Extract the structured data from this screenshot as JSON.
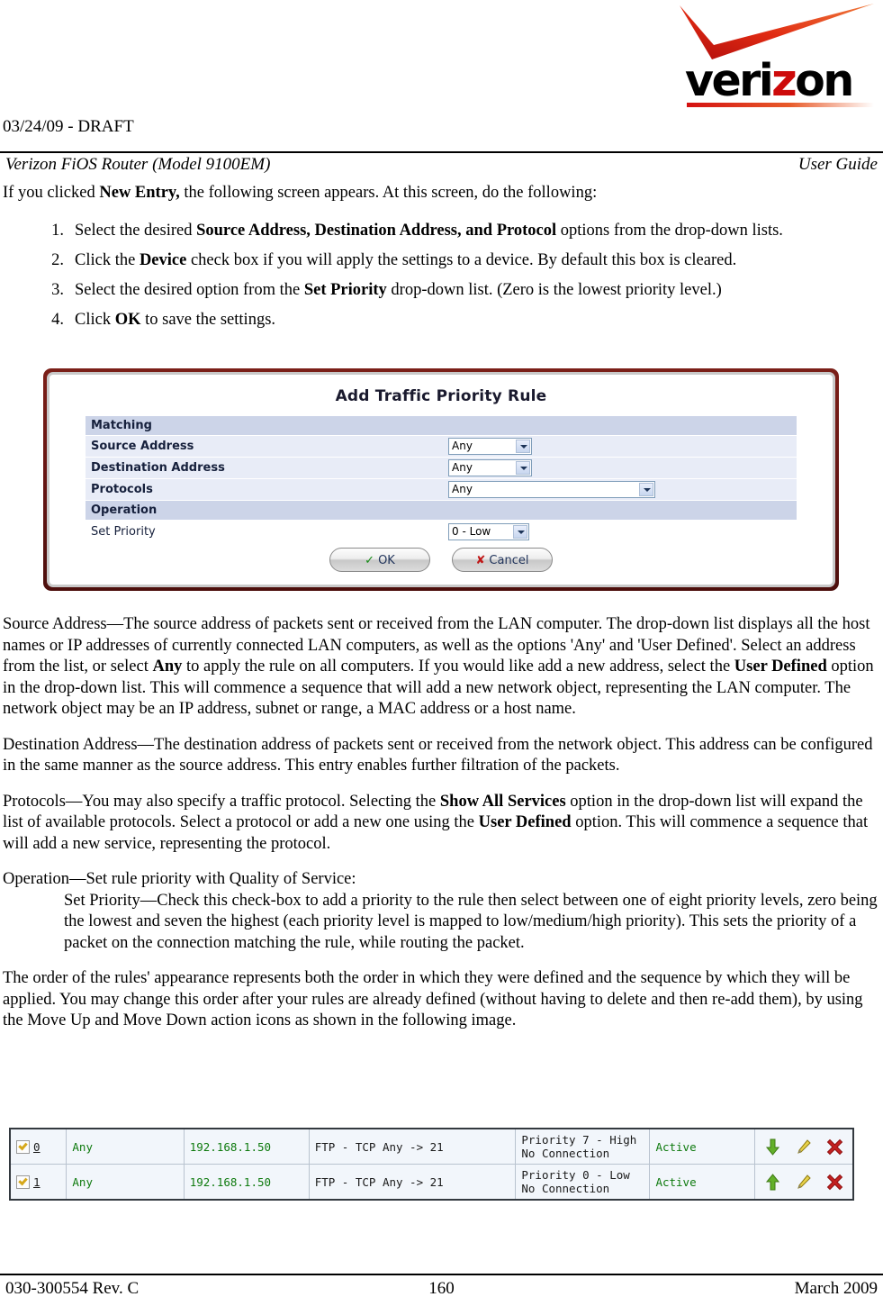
{
  "logo": {
    "wordmark": "verizon",
    "wordmark_prefix": "veri",
    "wordmark_z": "z",
    "wordmark_suffix": "on",
    "check_color": "#d41111",
    "z_color": "#cd0a0a"
  },
  "header": {
    "draft_line": "03/24/09 - DRAFT",
    "doc_title": "Verizon FiOS Router (Model 9100EM)",
    "doc_type": "User Guide"
  },
  "intro": {
    "before_bold": "If you clicked ",
    "bold": "New Entry,",
    "after_bold": " the following screen appears. At this screen, do the following:"
  },
  "steps": [
    {
      "num": "1.",
      "pre": "Select the desired ",
      "bold": "Source Address, Destination Address, and Protocol",
      "post": " options from the drop-down lists."
    },
    {
      "num": "2.",
      "pre": "Click the ",
      "bold": "Device",
      "post": " check box if you will apply the settings to a device. By default this box is cleared."
    },
    {
      "num": "3.",
      "pre": "Select the desired option from the ",
      "bold": "Set Priority",
      "post": " drop-down list. (Zero is the lowest priority level.)"
    },
    {
      "num": "4.",
      "pre": "Click ",
      "bold": "OK",
      "post": " to save the settings."
    }
  ],
  "dialog": {
    "title": "Add Traffic Priority Rule",
    "sections": [
      {
        "label": "Matching"
      },
      {
        "label": "Operation"
      }
    ],
    "fields": [
      {
        "label": "Source Address",
        "value": "Any",
        "width": "small"
      },
      {
        "label": "Destination Address",
        "value": "Any",
        "width": "small"
      },
      {
        "label": "Protocols",
        "value": "Any",
        "width": "wide"
      }
    ],
    "operation_field": {
      "label": "Set Priority",
      "value": "0 - Low"
    },
    "buttons": {
      "ok_mark": "✓",
      "ok_label": "OK",
      "cancel_mark": "✘",
      "cancel_label": "Cancel"
    }
  },
  "body_paragraphs": {
    "source_address": {
      "term": "Source Address",
      "dash": "—",
      "seg1": "The source address of packets sent or received from the LAN computer. The drop-down list displays all the host names or IP addresses of currently connected LAN computers, as well as the options 'Any' and 'User Defined'. Select an address from the list, or select ",
      "bold1": "Any",
      "seg2": " to apply the rule on all computers. If you would like add a new address, select the ",
      "bold2": "User Defined",
      "seg3": " option in the drop-down list. This will commence a sequence that will add a new network object, representing the LAN computer. The network object may be an IP address, subnet or range, a MAC address or a host name."
    },
    "destination_address": {
      "term": "Destination Address",
      "dash": "—",
      "seg1": "The destination address of packets sent or received from the network object. This address can be configured in the same manner as the source address. This entry enables further filtration of the packets."
    },
    "protocols": {
      "term": "Protocols",
      "dash": "—",
      "seg1": "You may also specify a traffic protocol. Selecting the ",
      "bold1": "Show All Services",
      "seg2": " option in the drop-down list will expand the list of available protocols. Select a protocol or add a new one using the ",
      "bold2": "User Defined",
      "seg3": " option. This will commence a sequence that will add a new service, representing the protocol."
    },
    "operation": {
      "term": "Operation",
      "dash": "—",
      "seg1": "Set rule priority with Quality of Service:"
    },
    "set_priority": {
      "term": "Set Priority",
      "dash": "—",
      "seg1": "Check this check-box to add a priority to the rule then select between one of eight priority levels, zero being the lowest and seven the highest (each priority level is mapped to low/medium/high priority). This sets the priority of a packet on the connection matching the rule, while routing the packet."
    },
    "rule_order": {
      "text": "The order of the rules' appearance represents both the order in which they were defined and the sequence by which they will be applied. You may change this order after your rules are already defined (without having to delete and then re-add them), by using the Move Up and Move Down action icons as shown in the following image."
    }
  },
  "rules_table": {
    "rows": [
      {
        "checked": true,
        "index": "0",
        "source": "Any",
        "destination": "192.168.1.50",
        "protocol": "FTP - TCP Any -> 21",
        "priority_line1": "Priority 7 - High",
        "priority_line2": "No Connection",
        "status": "Active",
        "move_icon": "arrow-down-icon",
        "actions": [
          "move-down-icon",
          "edit-icon",
          "delete-icon"
        ]
      },
      {
        "checked": true,
        "index": "1",
        "source": "Any",
        "destination": "192.168.1.50",
        "protocol": "FTP - TCP Any -> 21",
        "priority_line1": "Priority 0 - Low",
        "priority_line2": "No Connection",
        "status": "Active",
        "move_icon": "arrow-up-icon",
        "actions": [
          "move-up-icon",
          "edit-icon",
          "delete-icon"
        ]
      }
    ],
    "colors": {
      "green_text": "#0e7a0e",
      "row_bg": "#f2f6fb",
      "arrow_green": "#63b02a",
      "pencil_yellow": "#e8d24a",
      "delete_red": "#c42121"
    }
  },
  "footer": {
    "left": "030-300554 Rev. C",
    "center": "160",
    "right": "March 2009"
  }
}
